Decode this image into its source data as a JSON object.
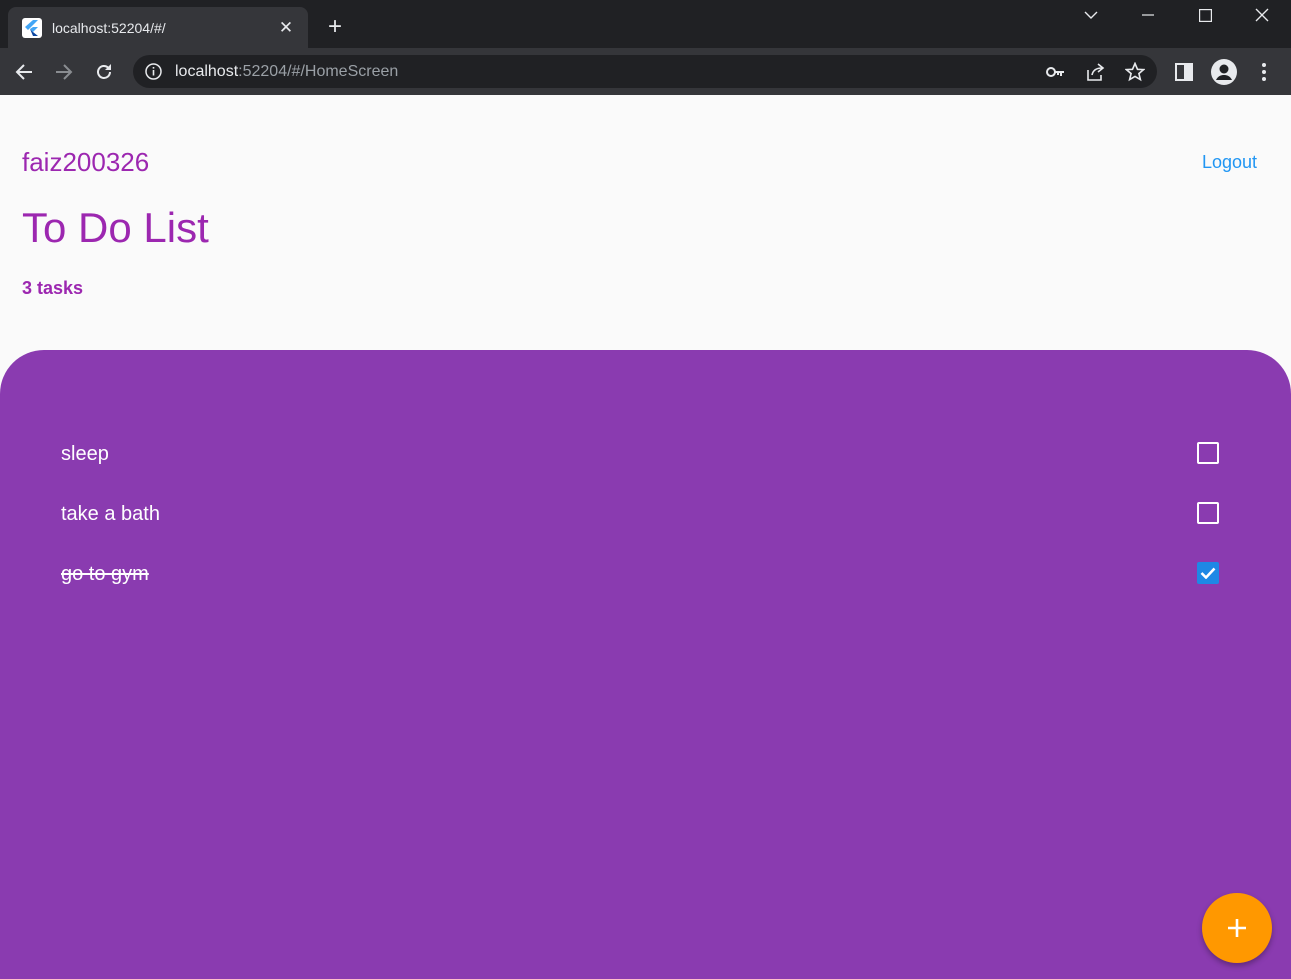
{
  "browser": {
    "tab": {
      "title": "localhost:52204/#/",
      "close_glyph": "✕"
    },
    "new_tab_glyph": "+",
    "url": {
      "host": "localhost",
      "rest": ":52204/#/HomeScreen"
    }
  },
  "header": {
    "username": "faiz200326",
    "logout_label": "Logout",
    "title": "To Do List",
    "task_count": "3 tasks"
  },
  "tasks": [
    {
      "label": "sleep",
      "done": false
    },
    {
      "label": "take a bath",
      "done": false
    },
    {
      "label": "go to gym",
      "done": true
    }
  ],
  "colors": {
    "primary": "#9c27b0",
    "panel": "#8a3bb0",
    "link": "#2196f3",
    "fab": "#ff9800",
    "checkbox_checked": "#1e88e5"
  },
  "icons": {
    "fab": "add-icon",
    "check": "check-icon"
  }
}
